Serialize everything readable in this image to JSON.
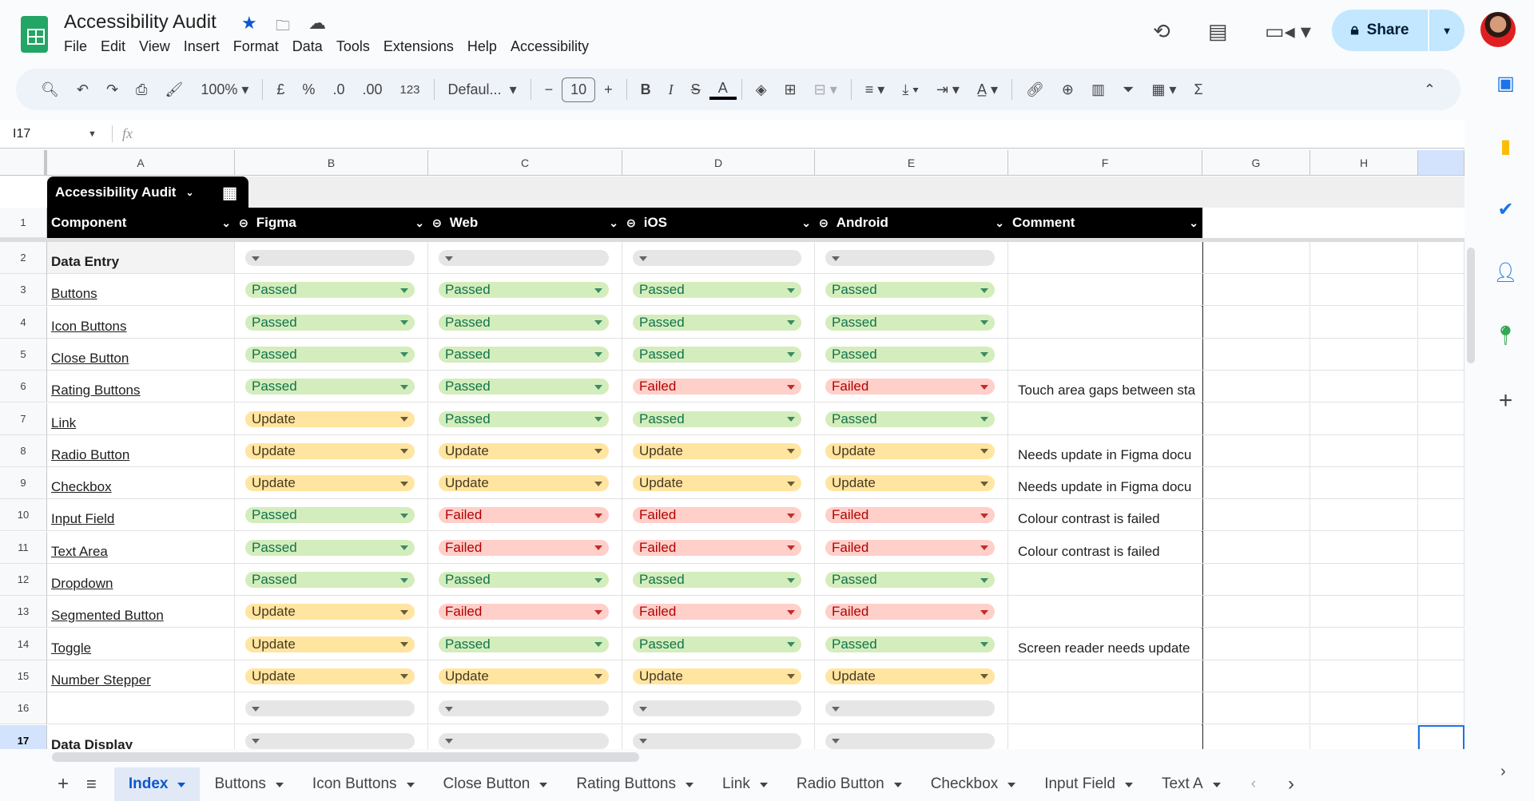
{
  "app": {
    "title": "Accessibility Audit",
    "menu": [
      "File",
      "Edit",
      "View",
      "Insert",
      "Format",
      "Data",
      "Tools",
      "Extensions",
      "Help",
      "Accessibility"
    ],
    "share_label": "Share"
  },
  "toolbar": {
    "zoom": "100%",
    "currency": "£",
    "percent": "%",
    "dec_decrease": ".0",
    "dec_increase": ".00",
    "number_format": "123",
    "font": "Defaul...",
    "font_size": "10",
    "bold": "B",
    "italic": "I",
    "text_color": "A",
    "sum": "Σ"
  },
  "formula_bar": {
    "cell_ref": "I17",
    "fx": "fx",
    "value": ""
  },
  "columns": [
    "A",
    "B",
    "C",
    "D",
    "E",
    "F",
    "G",
    "H"
  ],
  "table": {
    "name": "Accessibility Audit",
    "headers": [
      "Component",
      "Figma",
      "Web",
      "iOS",
      "Android",
      "Comment"
    ]
  },
  "status_colors": {
    "Passed": {
      "bg": "#d4edbc",
      "fg": "#11734b"
    },
    "Failed": {
      "bg": "#ffcfc9",
      "fg": "#b10202"
    },
    "Update": {
      "bg": "#ffe5a0",
      "fg": "#473821"
    },
    "": {
      "bg": "#e6e6e6",
      "fg": "#444444"
    }
  },
  "rows": [
    {
      "n": "2",
      "component": "Data Entry",
      "section": true,
      "s": [
        "",
        "",
        "",
        ""
      ],
      "comment": ""
    },
    {
      "n": "3",
      "component": "Buttons",
      "s": [
        "Passed",
        "Passed",
        "Passed",
        "Passed"
      ],
      "comment": ""
    },
    {
      "n": "4",
      "component": "Icon Buttons",
      "s": [
        "Passed",
        "Passed",
        "Passed",
        "Passed"
      ],
      "comment": ""
    },
    {
      "n": "5",
      "component": "Close Button",
      "s": [
        "Passed",
        "Passed",
        "Passed",
        "Passed"
      ],
      "comment": ""
    },
    {
      "n": "6",
      "component": "Rating Buttons",
      "s": [
        "Passed",
        "Passed",
        "Failed",
        "Failed"
      ],
      "comment": "Touch area gaps between sta"
    },
    {
      "n": "7",
      "component": "Link",
      "s": [
        "Update",
        "Passed",
        "Passed",
        "Passed"
      ],
      "comment": ""
    },
    {
      "n": "8",
      "component": "Radio Button",
      "s": [
        "Update",
        "Update",
        "Update",
        "Update"
      ],
      "comment": "Needs update in Figma docu"
    },
    {
      "n": "9",
      "component": "Checkbox",
      "s": [
        "Update",
        "Update",
        "Update",
        "Update"
      ],
      "comment": "Needs update in Figma docu"
    },
    {
      "n": "10",
      "component": "Input Field",
      "s": [
        "Passed",
        "Failed",
        "Failed",
        "Failed"
      ],
      "comment": "Colour contrast is failed"
    },
    {
      "n": "11",
      "component": "Text Area",
      "s": [
        "Passed",
        "Failed",
        "Failed",
        "Failed"
      ],
      "comment": "Colour contrast is failed"
    },
    {
      "n": "12",
      "component": "Dropdown",
      "s": [
        "Passed",
        "Passed",
        "Passed",
        "Passed"
      ],
      "comment": ""
    },
    {
      "n": "13",
      "component": "Segmented Button",
      "s": [
        "Update",
        "Failed",
        "Failed",
        "Failed"
      ],
      "comment": ""
    },
    {
      "n": "14",
      "component": "Toggle",
      "s": [
        "Update",
        "Passed",
        "Passed",
        "Passed"
      ],
      "comment": "Screen reader needs update"
    },
    {
      "n": "15",
      "component": "Number Stepper",
      "s": [
        "Update",
        "Update",
        "Update",
        "Update"
      ],
      "comment": ""
    },
    {
      "n": "16",
      "component": "",
      "s": [
        "",
        "",
        "",
        ""
      ],
      "comment": ""
    },
    {
      "n": "17",
      "component": "Data Display",
      "section": true,
      "s": [
        "",
        "",
        "",
        ""
      ],
      "comment": ""
    }
  ],
  "sheet_tabs": [
    "Index",
    "Buttons",
    "Icon Buttons",
    "Close Button",
    "Rating Buttons",
    "Link",
    "Radio Button",
    "Checkbox",
    "Input Field",
    "Text A"
  ],
  "active_tab": "Index"
}
